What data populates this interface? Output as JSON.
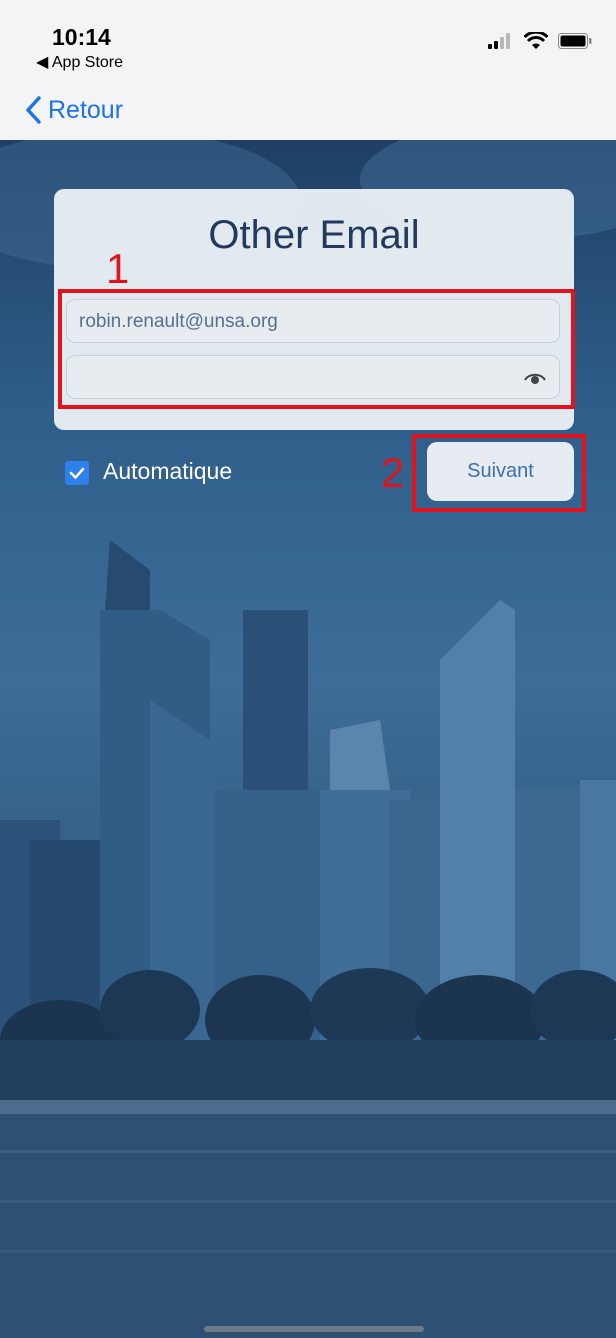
{
  "status_bar": {
    "time": "10:14",
    "back_app": "◀ App Store",
    "icons": [
      "signal-icon",
      "wifi-icon",
      "battery-icon"
    ]
  },
  "nav": {
    "back_label": "Retour"
  },
  "login": {
    "title": "Other Email",
    "email_value": "robin.renault@unsa.org",
    "password_value": "",
    "automatic_label": "Automatique",
    "automatic_checked": true,
    "next_label": "Suivant"
  },
  "annotations": {
    "label_1": "1",
    "label_2": "2",
    "color": "#e0141c"
  },
  "colors": {
    "accent": "#1a73e8",
    "button_text": "#3f6fae"
  }
}
